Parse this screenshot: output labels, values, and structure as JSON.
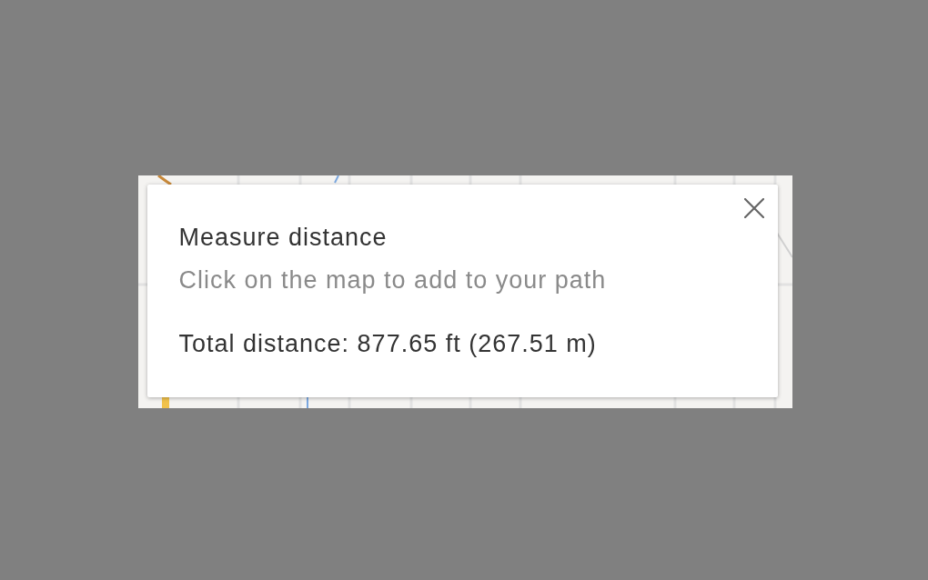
{
  "measure_panel": {
    "title": "Measure distance",
    "hint": "Click on the map to add to your path",
    "total": "Total distance: 877.65 ft (267.51 m)"
  }
}
